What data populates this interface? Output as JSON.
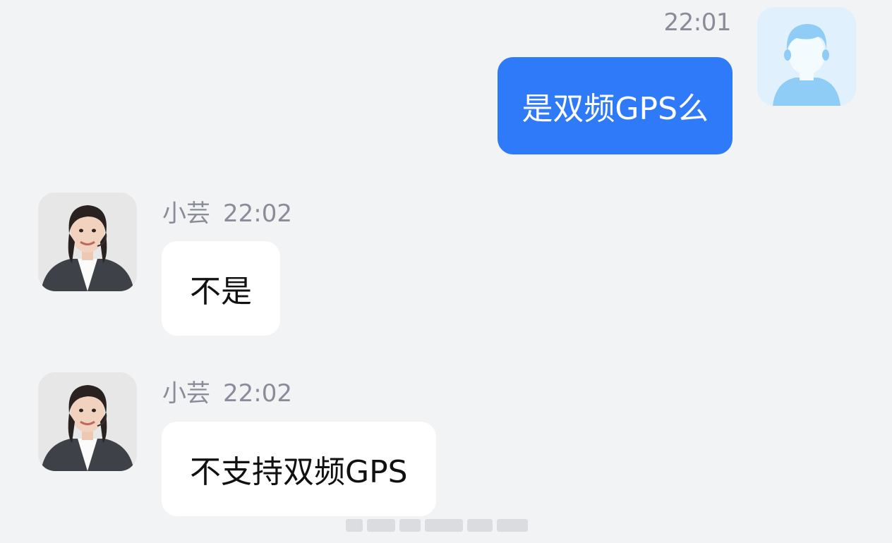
{
  "conversation": {
    "user_message": {
      "time": "22:01",
      "text": "是双频GPS么"
    },
    "agent_messages": [
      {
        "name": "小芸",
        "time": "22:02",
        "text": "不是"
      },
      {
        "name": "小芸",
        "time": "22:02",
        "text": "不支持双频GPS"
      }
    ]
  },
  "colors": {
    "background": "#f2f3f5",
    "user_bubble": "#2f7af8",
    "agent_bubble": "#ffffff",
    "meta_text": "#8a8d99"
  },
  "icons": {
    "user_avatar": "default-user-avatar-icon",
    "agent_avatar": "agent-photo-avatar"
  }
}
